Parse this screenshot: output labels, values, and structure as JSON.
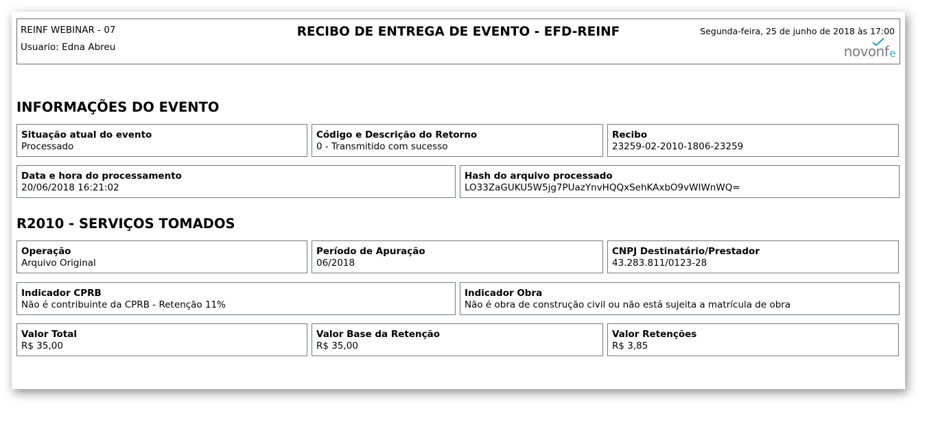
{
  "header": {
    "company": "REINF WEBINAR - 07",
    "user": "Usuario: Edna Abreu",
    "title": "RECIBO DE ENTREGA DE EVENTO - EFD-REINF",
    "date": "Segunda-feira, 25 de junho de 2018 às 17:00",
    "logo": {
      "part1": "novo",
      "part2": "nf",
      "part3": "e",
      "accent_color": "#3aa3c7"
    }
  },
  "evento": {
    "section_title": "INFORMAÇÕES DO EVENTO",
    "situacao": {
      "label": "Situação atual do evento",
      "value": "Processado"
    },
    "retorno": {
      "label": "Código e Descrição do Retorno",
      "value": "0 - Transmitido com sucesso"
    },
    "recibo": {
      "label": "Recibo",
      "value": "23259-02-2010-1806-23259"
    },
    "processamento": {
      "label": "Data e hora do processamento",
      "value": "20/06/2018 16:21:02"
    },
    "hash": {
      "label": "Hash do arquivo processado",
      "value": "LO33ZaGUKU5W5jg7PUazYnvHQQxSehKAxbO9vWIWnWQ="
    }
  },
  "servicos": {
    "section_title": "R2010 - SERVIÇOS TOMADOS",
    "operacao": {
      "label": "Operação",
      "value": "Arquivo Original"
    },
    "periodo": {
      "label": "Período de Apuração",
      "value": "06/2018"
    },
    "cnpj": {
      "label": "CNPJ Destinatário/Prestador",
      "value": "43.283.811/0123-28"
    },
    "cprb": {
      "label": "Indicador CPRB",
      "value": "Não é contribuinte da CPRB - Retenção 11%"
    },
    "obra": {
      "label": "Indicador Obra",
      "value": "Não é obra de construção civil ou não está sujeita a matrícula de obra"
    },
    "valor_total": {
      "label": "Valor Total",
      "value": "R$ 35,00"
    },
    "valor_base": {
      "label": "Valor Base da Retenção",
      "value": "R$ 35,00"
    },
    "valor_retencoes": {
      "label": "Valor Retenções",
      "value": "R$ 3,85"
    }
  }
}
